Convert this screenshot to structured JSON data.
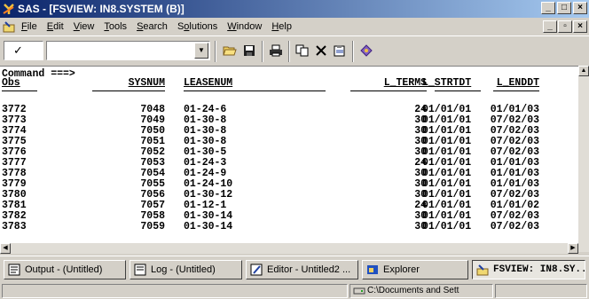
{
  "window": {
    "title": "SAS - [FSVIEW:  IN8.SYSTEM (B)]"
  },
  "menubar": {
    "items": [
      "File",
      "Edit",
      "View",
      "Tools",
      "Search",
      "Solutions",
      "Window",
      "Help"
    ],
    "accel": [
      "F",
      "E",
      "V",
      "T",
      "S",
      "o",
      "W",
      "H"
    ]
  },
  "toolbar": {
    "check_glyph": "✓",
    "command_value": ""
  },
  "table": {
    "command_prompt": "Command ===>",
    "columns": [
      "Obs",
      "SYSNUM",
      "LEASENUM",
      "L_TERMS",
      "L_STRTDT",
      "L_ENDDT"
    ],
    "rows": [
      [
        "3772",
        "7048",
        "01-24-6",
        "24",
        "01/01/01",
        "01/01/03"
      ],
      [
        "3773",
        "7049",
        "01-30-8",
        "30",
        "01/01/01",
        "07/02/03"
      ],
      [
        "3774",
        "7050",
        "01-30-8",
        "30",
        "01/01/01",
        "07/02/03"
      ],
      [
        "3775",
        "7051",
        "01-30-8",
        "30",
        "01/01/01",
        "07/02/03"
      ],
      [
        "3776",
        "7052",
        "01-30-5",
        "30",
        "01/01/01",
        "07/02/03"
      ],
      [
        "3777",
        "7053",
        "01-24-3",
        "24",
        "01/01/01",
        "01/01/03"
      ],
      [
        "3778",
        "7054",
        "01-24-9",
        "30",
        "01/01/01",
        "01/01/03"
      ],
      [
        "3779",
        "7055",
        "01-24-10",
        "30",
        "01/01/01",
        "01/01/03"
      ],
      [
        "3780",
        "7056",
        "01-30-12",
        "30",
        "01/01/01",
        "07/02/03"
      ],
      [
        "3781",
        "7057",
        "01-12-1",
        "24",
        "01/01/01",
        "01/01/02"
      ],
      [
        "3782",
        "7058",
        "01-30-14",
        "30",
        "01/01/01",
        "07/02/03"
      ],
      [
        "3783",
        "7059",
        "01-30-14",
        "30",
        "01/01/01",
        "07/02/03"
      ]
    ]
  },
  "taskbar": {
    "items": [
      {
        "label": "Output - (Untitled)",
        "icon": "output-icon"
      },
      {
        "label": "Log - (Untitled)",
        "icon": "log-icon"
      },
      {
        "label": "Editor - Untitled2 ...",
        "icon": "editor-icon"
      },
      {
        "label": "Explorer",
        "icon": "explorer-icon"
      },
      {
        "label": "FSVIEW: IN8.SY...",
        "icon": "fsview-icon"
      }
    ]
  },
  "statusbar": {
    "path": "C:\\Documents and Sett"
  },
  "colors": {
    "title_start": "#0a246a",
    "title_end": "#a6caf0",
    "chrome": "#d4d0c8"
  }
}
